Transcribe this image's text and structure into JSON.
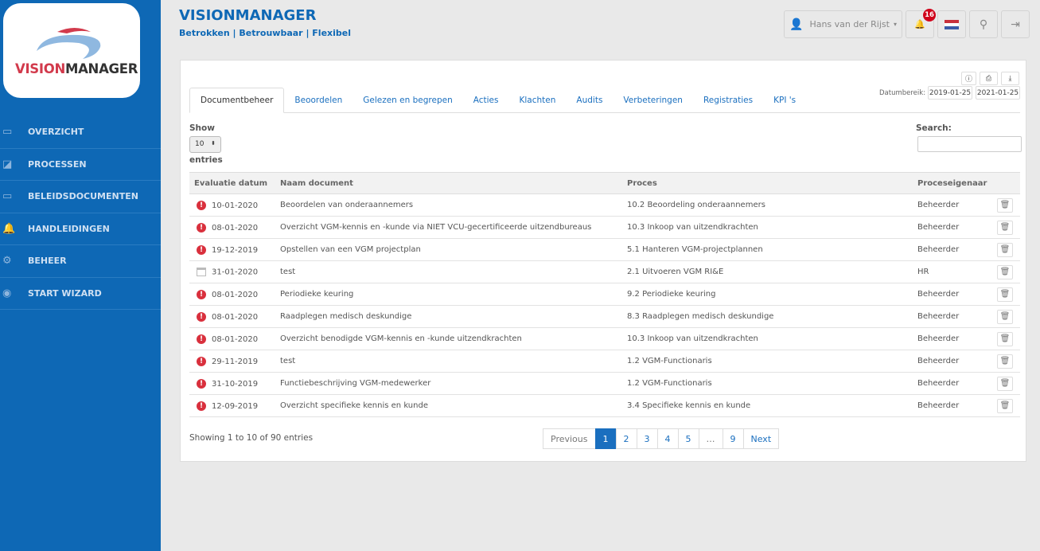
{
  "logo": {
    "text_a": "VISION",
    "text_b": "MANAGER"
  },
  "sidebar": {
    "items": [
      {
        "label": "OVERZICHT",
        "icon": "inbox-icon"
      },
      {
        "label": "PROCESSEN",
        "icon": "chart-icon"
      },
      {
        "label": "BELEIDSDOCUMENTEN",
        "icon": "inbox-icon"
      },
      {
        "label": "HANDLEIDINGEN",
        "icon": "bell-icon"
      },
      {
        "label": "BEHEER",
        "icon": "gear-icon"
      },
      {
        "label": "START WIZARD",
        "icon": "eye-icon"
      }
    ]
  },
  "header": {
    "title": "VISIONMANAGER",
    "tagline": "Betrokken | Betrouwbaar | Flexibel",
    "user": "Hans van der Rijst",
    "notifications": "16"
  },
  "colors": {
    "primary": "#0e68b5",
    "alert": "#d9303d"
  },
  "toolbar": {
    "date_label": "Datumbereik:",
    "date_from": "2019-01-25",
    "date_to": "2021-01-25"
  },
  "tabs": [
    "Documentbeheer",
    "Beoordelen",
    "Gelezen en begrepen",
    "Acties",
    "Klachten",
    "Audits",
    "Verbeteringen",
    "Registraties",
    "KPI 's"
  ],
  "table_controls": {
    "show": "Show",
    "length": "10",
    "entries": "entries",
    "search": "Search:",
    "search_value": ""
  },
  "columns": [
    "Evaluatie datum",
    "Naam document",
    "Proces",
    "Proceseigenaar"
  ],
  "rows": [
    {
      "icon": "alert",
      "date": "10-01-2020",
      "name": "Beoordelen van onderaannemers",
      "proces": "10.2 Beoordeling onderaannemers",
      "owner": "Beheerder"
    },
    {
      "icon": "alert",
      "date": "08-01-2020",
      "name": "Overzicht VGM-kennis en -kunde via NIET VCU-gecertificeerde uitzendbureaus",
      "proces": "10.3 Inkoop van uitzendkrachten",
      "owner": "Beheerder"
    },
    {
      "icon": "alert",
      "date": "19-12-2019",
      "name": "Opstellen van een VGM projectplan",
      "proces": "5.1 Hanteren VGM-projectplannen",
      "owner": "Beheerder"
    },
    {
      "icon": "calendar",
      "date": "31-01-2020",
      "name": "test",
      "proces": "2.1 Uitvoeren VGM RI&E",
      "owner": "HR"
    },
    {
      "icon": "alert",
      "date": "08-01-2020",
      "name": "Periodieke keuring",
      "proces": "9.2 Periodieke keuring",
      "owner": "Beheerder"
    },
    {
      "icon": "alert",
      "date": "08-01-2020",
      "name": "Raadplegen medisch deskundige",
      "proces": "8.3 Raadplegen medisch deskundige",
      "owner": "Beheerder"
    },
    {
      "icon": "alert",
      "date": "08-01-2020",
      "name": "Overzicht benodigde VGM-kennis en -kunde uitzendkrachten",
      "proces": "10.3 Inkoop van uitzendkrachten",
      "owner": "Beheerder"
    },
    {
      "icon": "alert",
      "date": "29-11-2019",
      "name": "test",
      "proces": "1.2 VGM-Functionaris",
      "owner": "Beheerder"
    },
    {
      "icon": "alert",
      "date": "31-10-2019",
      "name": "Functiebeschrijving VGM-medewerker",
      "proces": "1.2 VGM-Functionaris",
      "owner": "Beheerder"
    },
    {
      "icon": "alert",
      "date": "12-09-2019",
      "name": "Overzicht specifieke kennis en kunde",
      "proces": "3.4 Specifieke kennis en kunde",
      "owner": "Beheerder"
    }
  ],
  "footer": {
    "info": "Showing 1 to 10 of 90 entries",
    "pages": [
      "Previous",
      "1",
      "2",
      "3",
      "4",
      "5",
      "…",
      "9",
      "Next"
    ],
    "current": "1"
  }
}
